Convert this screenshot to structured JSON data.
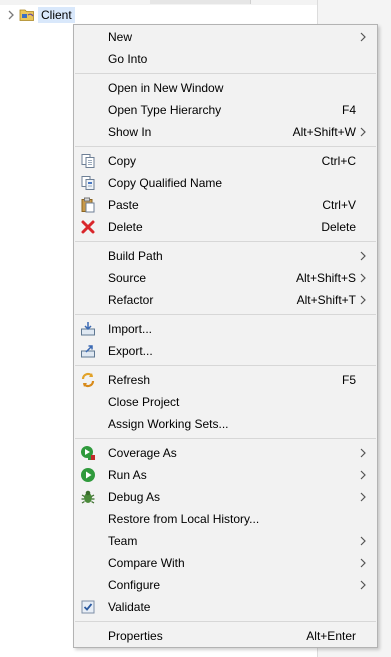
{
  "tree": {
    "label": "Client"
  },
  "menu": {
    "items": [
      {
        "label": "New",
        "shortcut": "",
        "submenu": true,
        "icon": ""
      },
      {
        "label": "Go Into",
        "shortcut": "",
        "submenu": false,
        "icon": ""
      },
      {
        "label": "Open in New Window",
        "shortcut": "",
        "submenu": false,
        "icon": ""
      },
      {
        "label": "Open Type Hierarchy",
        "shortcut": "F4",
        "submenu": false,
        "icon": ""
      },
      {
        "label": "Show In",
        "shortcut": "Alt+Shift+W",
        "submenu": true,
        "icon": ""
      },
      {
        "label": "Copy",
        "shortcut": "Ctrl+C",
        "submenu": false,
        "icon": "copy-icon"
      },
      {
        "label": "Copy Qualified Name",
        "shortcut": "",
        "submenu": false,
        "icon": "copy-qualified-name-icon"
      },
      {
        "label": "Paste",
        "shortcut": "Ctrl+V",
        "submenu": false,
        "icon": "paste-icon"
      },
      {
        "label": "Delete",
        "shortcut": "Delete",
        "submenu": false,
        "icon": "delete-icon"
      },
      {
        "label": "Build Path",
        "shortcut": "",
        "submenu": true,
        "icon": ""
      },
      {
        "label": "Source",
        "shortcut": "Alt+Shift+S",
        "submenu": true,
        "icon": ""
      },
      {
        "label": "Refactor",
        "shortcut": "Alt+Shift+T",
        "submenu": true,
        "icon": ""
      },
      {
        "label": "Import...",
        "shortcut": "",
        "submenu": false,
        "icon": "import-icon"
      },
      {
        "label": "Export...",
        "shortcut": "",
        "submenu": false,
        "icon": "export-icon"
      },
      {
        "label": "Refresh",
        "shortcut": "F5",
        "submenu": false,
        "icon": "refresh-icon"
      },
      {
        "label": "Close Project",
        "shortcut": "",
        "submenu": false,
        "icon": ""
      },
      {
        "label": "Assign Working Sets...",
        "shortcut": "",
        "submenu": false,
        "icon": ""
      },
      {
        "label": "Coverage As",
        "shortcut": "",
        "submenu": true,
        "icon": "coverage-icon"
      },
      {
        "label": "Run As",
        "shortcut": "",
        "submenu": true,
        "icon": "run-icon"
      },
      {
        "label": "Debug As",
        "shortcut": "",
        "submenu": true,
        "icon": "debug-icon"
      },
      {
        "label": "Restore from Local History...",
        "shortcut": "",
        "submenu": false,
        "icon": ""
      },
      {
        "label": "Team",
        "shortcut": "",
        "submenu": true,
        "icon": ""
      },
      {
        "label": "Compare With",
        "shortcut": "",
        "submenu": true,
        "icon": ""
      },
      {
        "label": "Configure",
        "shortcut": "",
        "submenu": true,
        "icon": ""
      },
      {
        "label": "Validate",
        "shortcut": "",
        "submenu": false,
        "icon": "validate-check-icon"
      },
      {
        "label": "Properties",
        "shortcut": "Alt+Enter",
        "submenu": false,
        "icon": ""
      }
    ]
  }
}
